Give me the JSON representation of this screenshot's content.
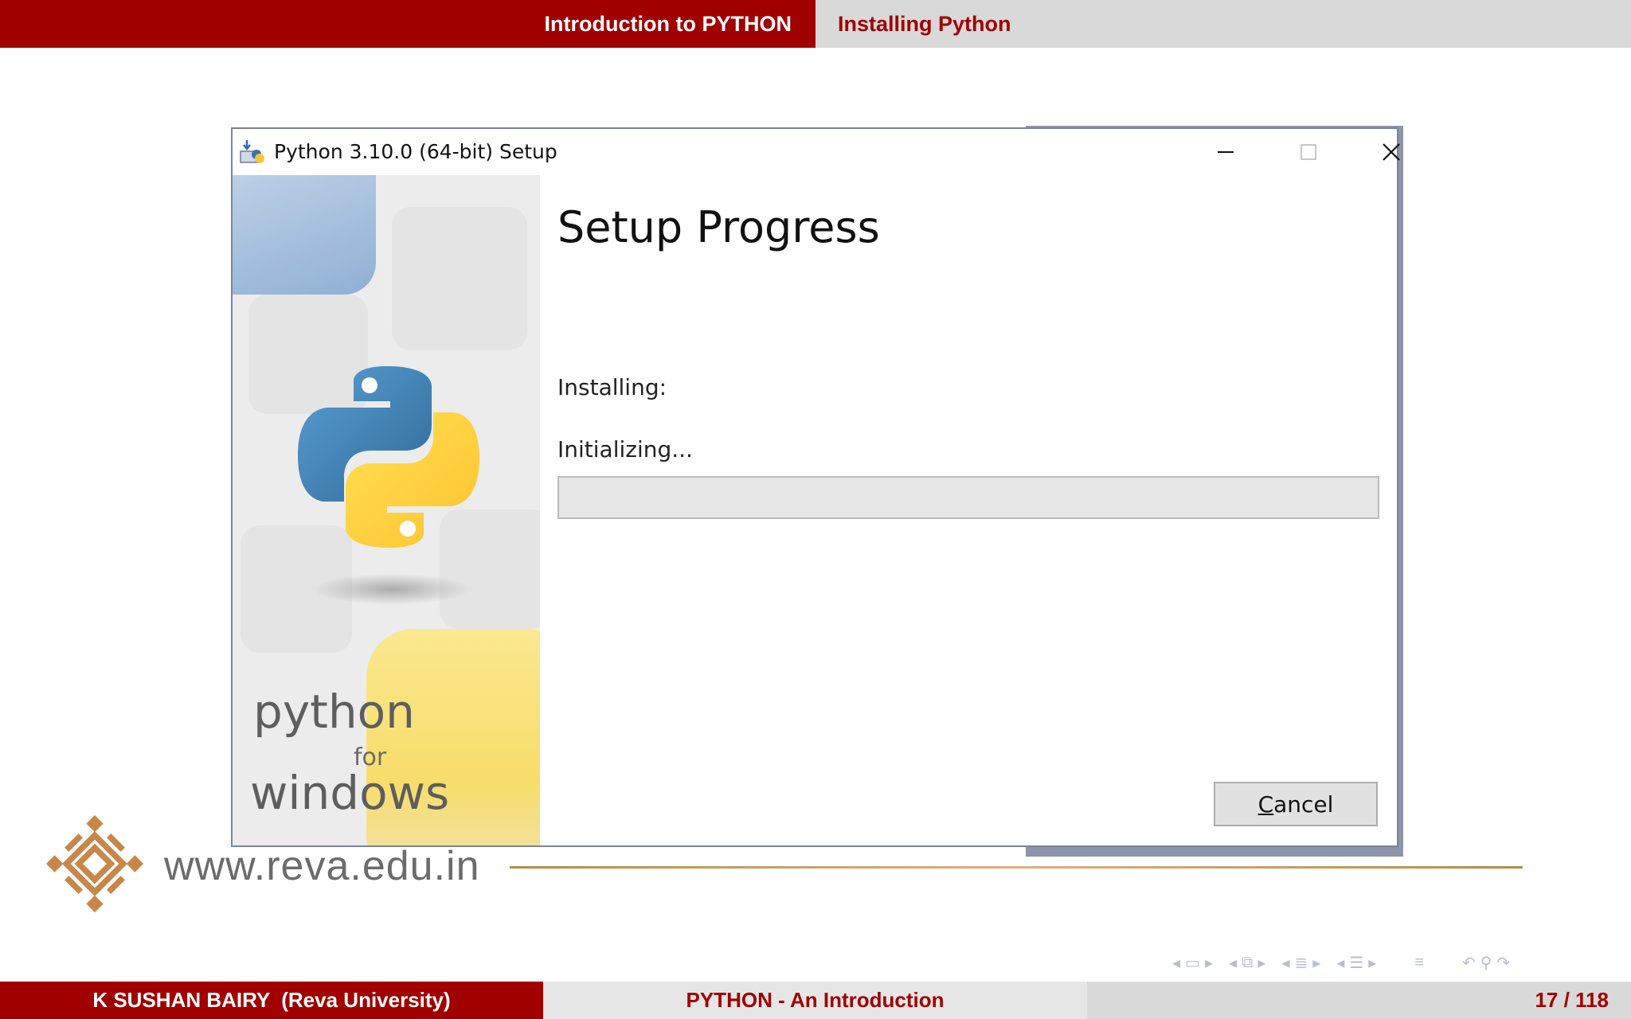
{
  "slide": {
    "header_section": "Introduction to PYTHON",
    "header_subsection": "Installing Python",
    "footer_author": "K SUSHAN BAIRY  (Reva University)",
    "footer_title": "PYTHON - An Introduction",
    "footer_page": "17 / 118",
    "reva_url": "www.reva.edu.in",
    "accent_color": "#a10000"
  },
  "window": {
    "title": "Python 3.10.0 (64-bit) Setup",
    "heading": "Setup Progress",
    "installing_label": "Installing:",
    "status_text": "Initializing...",
    "progress": 0,
    "cancel_mnemonic": "C",
    "cancel_rest": "ancel",
    "brand_python": "python",
    "brand_for": "for",
    "brand_windows": "windows"
  },
  "icons": [
    "python-setup-icon",
    "minimize-icon",
    "maximize-icon",
    "close-icon",
    "python-logo-icon",
    "reva-logo-icon"
  ]
}
